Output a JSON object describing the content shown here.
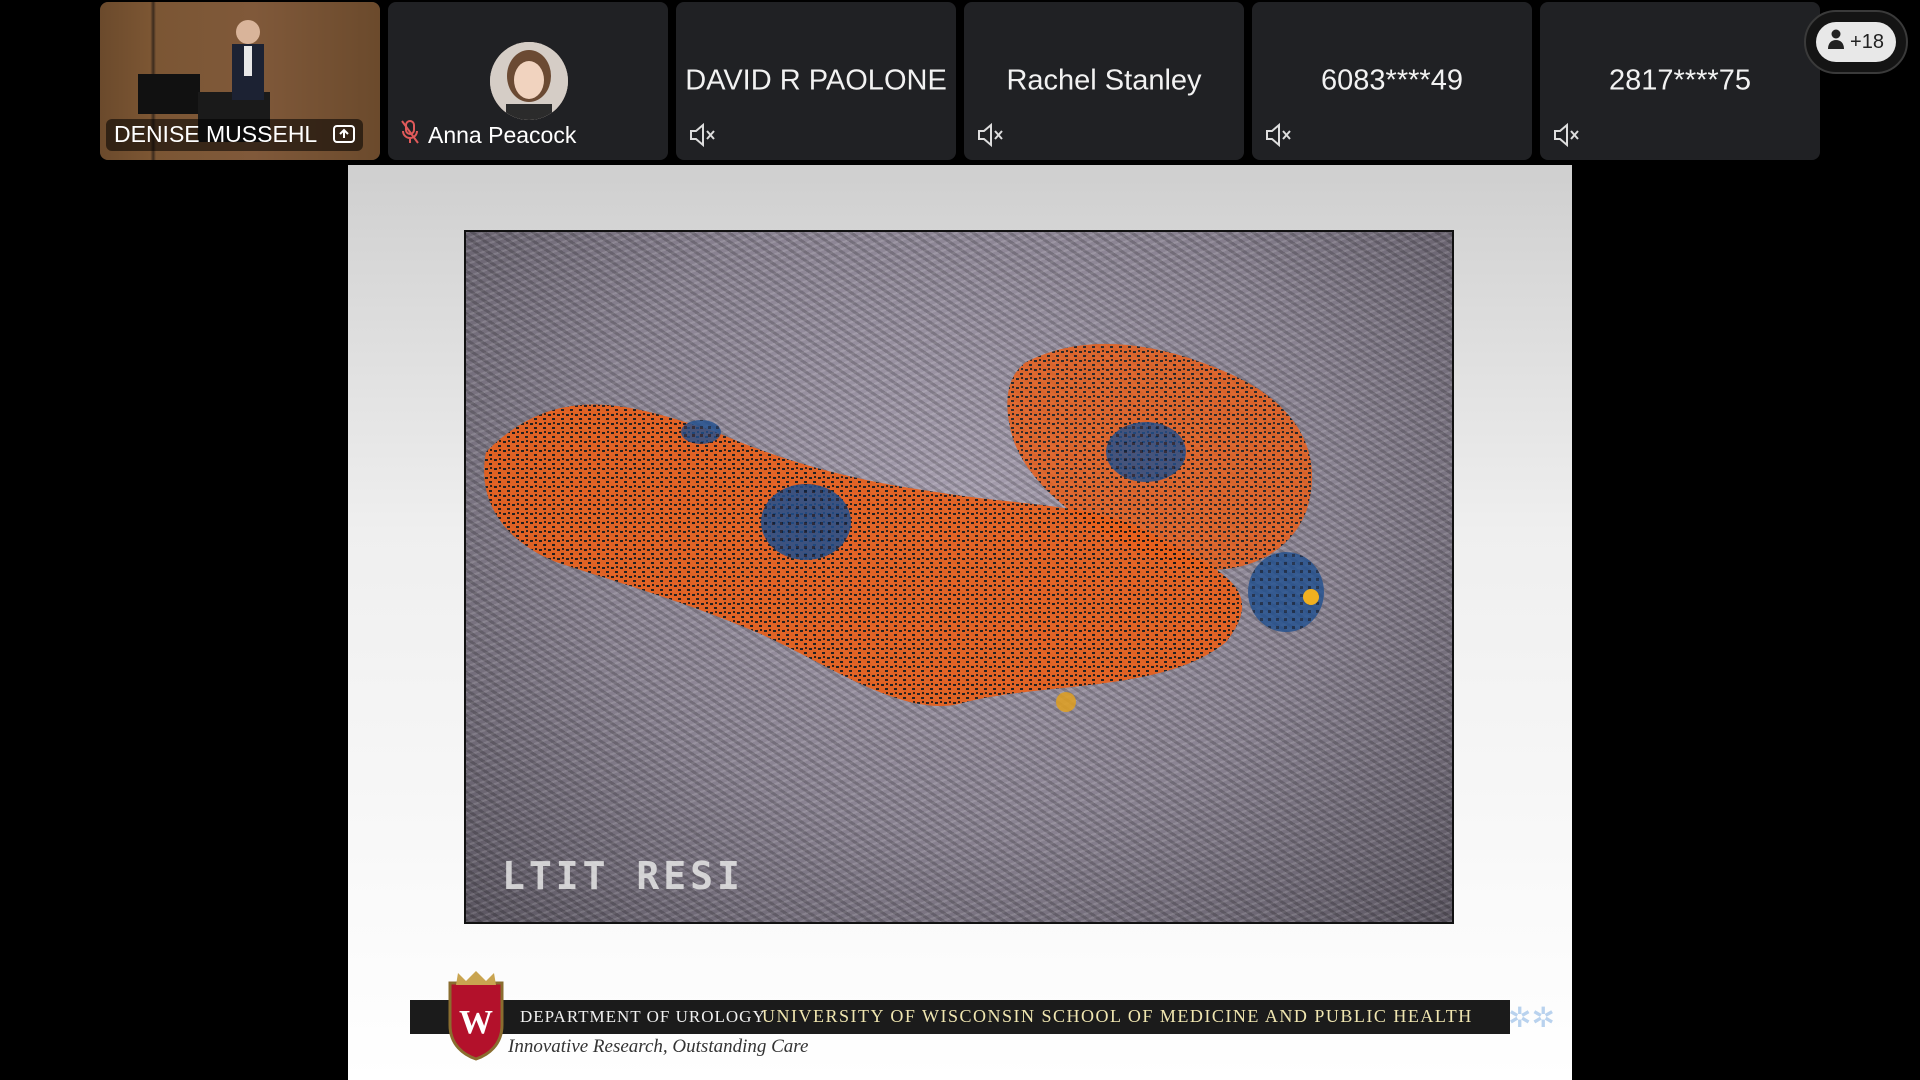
{
  "participants": [
    {
      "name": "DENISE MUSSEHL",
      "type": "video",
      "badge": "screen-share-icon"
    },
    {
      "name": "Anna Peacock",
      "type": "avatar",
      "mic": "mic-off-icon"
    },
    {
      "name": "DAVID R PAOLONE",
      "type": "text",
      "mic": "speaker-muted-icon"
    },
    {
      "name": "Rachel Stanley",
      "type": "text",
      "mic": "speaker-muted-icon"
    },
    {
      "name": "6083****49",
      "type": "text",
      "mic": "speaker-muted-icon"
    },
    {
      "name": "2817****75",
      "type": "text",
      "mic": "speaker-muted-icon"
    }
  ],
  "overflow": {
    "label": "+18",
    "icon": "person-icon"
  },
  "slide": {
    "ultrasound_caption": "LTIT RESI",
    "department": "DEPARTMENT OF UROLOGY",
    "university": "UNIVERSITY OF WISCONSIN SCHOOL OF MEDICINE AND PUBLIC HEALTH",
    "tagline": "Innovative Research, Outstanding Care",
    "crest_letter": "W"
  },
  "colors": {
    "tile_bg": "#202124",
    "mic_off_red": "#e05a5a",
    "crest_red": "#b3112b"
  }
}
